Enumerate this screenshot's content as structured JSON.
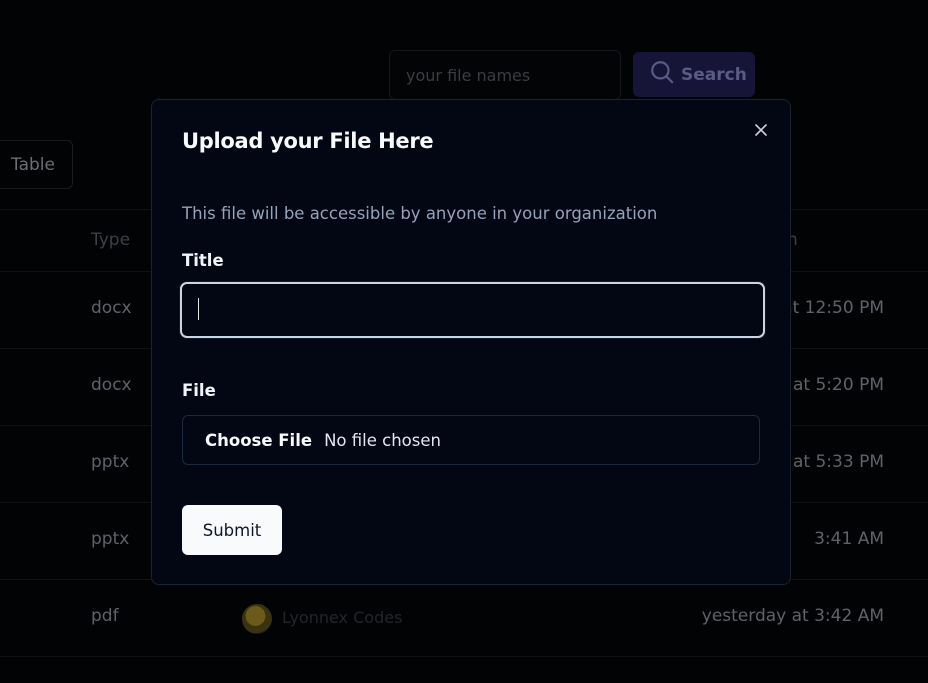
{
  "background": {
    "search": {
      "placeholder": "your file names",
      "button_label": "Search"
    },
    "view_toggle": "Table",
    "table": {
      "headers": {
        "type": "Type",
        "created": "n"
      },
      "rows": [
        {
          "type": "docx",
          "date": "at 12:50 PM"
        },
        {
          "type": "docx",
          "date": "at 5:20 PM"
        },
        {
          "type": "pptx",
          "date": "at 5:33 PM"
        },
        {
          "type": "pptx",
          "date": "3:41 AM"
        },
        {
          "type": "pdf",
          "owner": "Lyonnex Codes",
          "date": "yesterday at 3:42 AM"
        }
      ]
    }
  },
  "modal": {
    "title": "Upload your File Here",
    "description": "This file will be accessible by anyone in your organization",
    "title_label": "Title",
    "title_value": "",
    "file_label": "File",
    "choose_file_label": "Choose File",
    "no_file_text": "No file chosen",
    "submit_label": "Submit"
  }
}
